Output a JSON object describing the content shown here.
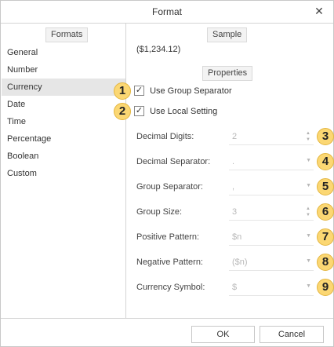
{
  "dialog": {
    "title": "Format",
    "close_glyph": "✕"
  },
  "formats": {
    "header": "Formats",
    "items": [
      "General",
      "Number",
      "Currency",
      "Date",
      "Time",
      "Percentage",
      "Boolean",
      "Custom"
    ],
    "selected": "Currency"
  },
  "sample": {
    "header": "Sample",
    "value": "($1,234.12)"
  },
  "properties": {
    "header": "Properties",
    "use_group_separator": {
      "label": "Use Group Separator",
      "checked": true,
      "check_glyph": "✓"
    },
    "use_local_setting": {
      "label": "Use Local Setting",
      "checked": true,
      "check_glyph": "✓"
    },
    "fields": [
      {
        "label": "Decimal Digits:",
        "value": "2",
        "control": "spinner"
      },
      {
        "label": "Decimal Separator:",
        "value": ".",
        "control": "dropdown"
      },
      {
        "label": "Group Separator:",
        "value": ",",
        "control": "dropdown"
      },
      {
        "label": "Group Size:",
        "value": "3",
        "control": "spinner"
      },
      {
        "label": "Positive Pattern:",
        "value": "$n",
        "control": "dropdown"
      },
      {
        "label": "Negative Pattern:",
        "value": "($n)",
        "control": "dropdown"
      },
      {
        "label": "Currency Symbol:",
        "value": "$",
        "control": "dropdown"
      }
    ]
  },
  "callouts": [
    "1",
    "2",
    "3",
    "4",
    "5",
    "6",
    "7",
    "8",
    "9"
  ],
  "icons": {
    "spin_up": "▲",
    "spin_down": "▼",
    "dropdown": "▼"
  },
  "buttons": {
    "ok": "OK",
    "cancel": "Cancel"
  },
  "colors": {
    "callout_fill": "#fbd773",
    "callout_border": "#e4b640",
    "selected_row": "#e6e6e6"
  }
}
